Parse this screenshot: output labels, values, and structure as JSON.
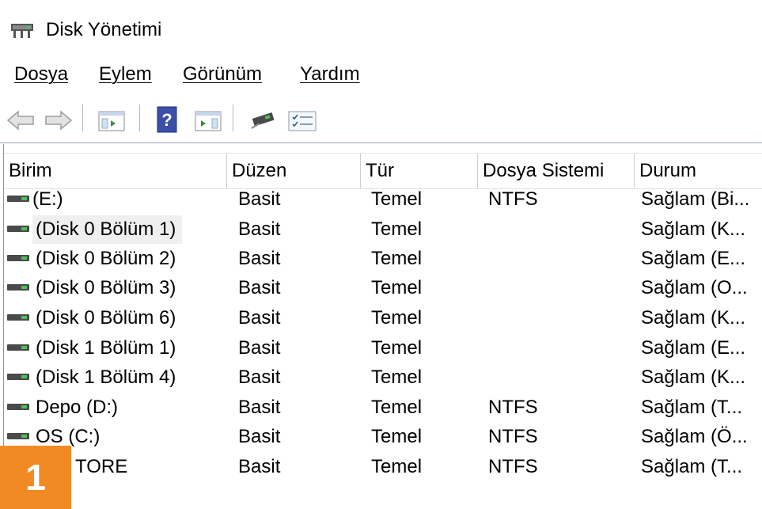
{
  "window": {
    "title": "Disk Yönetimi"
  },
  "menu": [
    {
      "first": "D",
      "rest": "osya"
    },
    {
      "first": "E",
      "rest": "ylem"
    },
    {
      "first": "G",
      "rest": "örünüm"
    },
    {
      "first": "Y",
      "rest": "ardım"
    }
  ],
  "toolbar": {
    "icons": [
      "back-arrow-icon",
      "forward-arrow-icon",
      "console-tree-icon",
      "help-icon",
      "action-pane-icon",
      "connect-disk-icon",
      "properties-icon"
    ]
  },
  "table": {
    "columns": [
      "Birim",
      "Düzen",
      "Tür",
      "Dosya Sistemi",
      "Durum"
    ],
    "rows": [
      {
        "birim": " (E:)",
        "duzen": "Basit",
        "tur": "Temel",
        "fs": "NTFS",
        "durum": "Sağlam (Bi..."
      },
      {
        "birim": "(Disk 0 Bölüm 1)",
        "duzen": "Basit",
        "tur": "Temel",
        "fs": "",
        "durum": "Sağlam (K..."
      },
      {
        "birim": "(Disk 0 Bölüm 2)",
        "duzen": "Basit",
        "tur": "Temel",
        "fs": "",
        "durum": "Sağlam (E..."
      },
      {
        "birim": "(Disk 0 Bölüm 3)",
        "duzen": "Basit",
        "tur": "Temel",
        "fs": "",
        "durum": "Sağlam (O..."
      },
      {
        "birim": "(Disk 0 Bölüm 6)",
        "duzen": "Basit",
        "tur": "Temel",
        "fs": "",
        "durum": "Sağlam (K..."
      },
      {
        "birim": "(Disk 1 Bölüm 1)",
        "duzen": "Basit",
        "tur": "Temel",
        "fs": "",
        "durum": "Sağlam (E..."
      },
      {
        "birim": "(Disk 1 Bölüm 4)",
        "duzen": "Basit",
        "tur": "Temel",
        "fs": "",
        "durum": "Sağlam (K..."
      },
      {
        "birim": "Depo (D:)",
        "duzen": "Basit",
        "tur": "Temel",
        "fs": "NTFS",
        "durum": "Sağlam (T..."
      },
      {
        "birim": "OS (C:)",
        "duzen": "Basit",
        "tur": "Temel",
        "fs": "NTFS",
        "durum": "Sağlam (Ö..."
      },
      {
        "birim": "TORE",
        "duzen": "Basit",
        "tur": "Temel",
        "fs": "NTFS",
        "durum": "Sağlam (T..."
      }
    ]
  },
  "badge": {
    "number": "1"
  },
  "colors": {
    "badge": "#f28a24",
    "selection": "#efefef"
  }
}
